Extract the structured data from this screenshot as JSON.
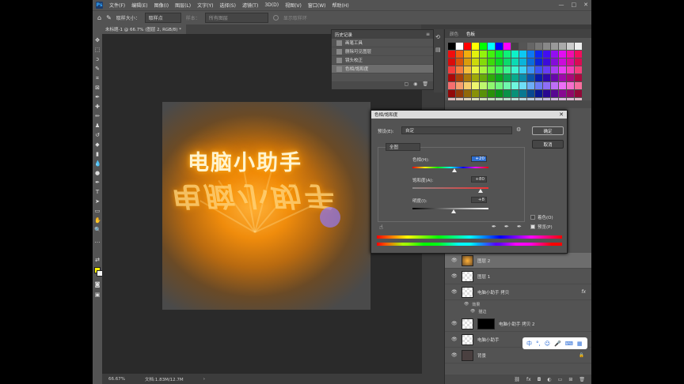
{
  "menu": [
    "文件(F)",
    "编辑(E)",
    "图像(I)",
    "图层(L)",
    "文字(Y)",
    "选择(S)",
    "滤镜(T)",
    "3D(D)",
    "视图(V)",
    "窗口(W)",
    "帮助(H)"
  ],
  "logo": "Ps",
  "window_controls": [
    "—",
    "□",
    "✕"
  ],
  "options": {
    "sample_size_label": "取样大小：",
    "sample_size_value": "取样点",
    "sample_label": "样本：",
    "sample_value": "所有图层",
    "show_ring": "显示取样环"
  },
  "document_tab": "未标题-1 @ 66.7% (图层 2, RGB/8) *",
  "canvas": {
    "headline": "电脑小助手",
    "reflection": "电脑小助手"
  },
  "status": {
    "zoom": "66.67%",
    "doc": "文档:1.83M/12.7M"
  },
  "history": {
    "tab": "历史记录",
    "items": [
      "画笔工具",
      "删除可见图层",
      "镜头校正",
      "色相/饱和度"
    ],
    "active_index": 3
  },
  "swatches": {
    "tabs": [
      "颜色",
      "色板"
    ],
    "active_tab": "色板"
  },
  "layers": [
    {
      "name": "图层 2",
      "thumb": "orange",
      "active": true
    },
    {
      "name": "图层 1",
      "thumb": "checker"
    },
    {
      "name": "电脑小助手 拷贝",
      "thumb": "checker",
      "fx": "fx"
    },
    {
      "name": "电脑小助手 拷贝 2",
      "thumb": "checker",
      "mask": true
    },
    {
      "name": "电脑小助手",
      "thumb": "checker"
    },
    {
      "name": "背景",
      "thumb": "dark"
    }
  ],
  "layer_effects": {
    "label": "效果",
    "item": "描边"
  },
  "ime": [
    "中",
    "°,",
    "☺",
    "🎤",
    "⌨",
    "▦"
  ],
  "dialog": {
    "title": "色相/饱和度",
    "preset_label": "预设(E):",
    "preset_value": "自定",
    "ok": "确定",
    "cancel": "取消",
    "channel": "全图",
    "hue_label": "色相(H):",
    "hue_value": "+20",
    "sat_label": "饱和度(A):",
    "sat_value": "+80",
    "light_label": "明度(I):",
    "light_value": "+8",
    "colorize": "着色(O)",
    "preview": "预览(P)",
    "colorize_checked": false,
    "preview_checked": true
  },
  "colors": {
    "hue": 20,
    "saturation": 80,
    "lightness": 8,
    "fg": "#fff200",
    "bg": "#f5f5f5"
  }
}
